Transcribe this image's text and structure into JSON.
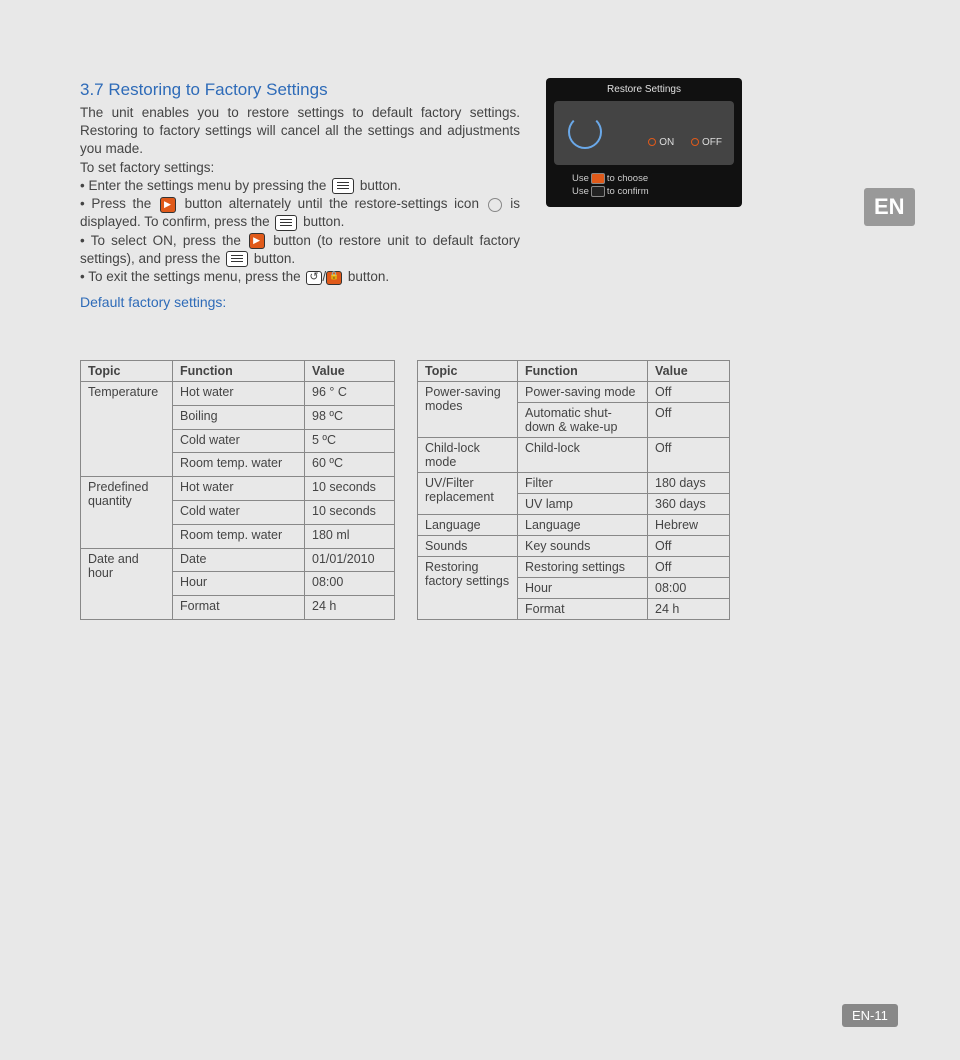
{
  "section_title": "3.7 Restoring to Factory Settings",
  "intro_1": "The unit enables you to restore settings to default factory settings. Restoring to factory settings will cancel all the settings and adjustments you made.",
  "intro_2": "To set factory settings:",
  "bullet_1a": "• Enter the settings menu by pressing the ",
  "bullet_1b": " button.",
  "bullet_2a": "• Press the ",
  "bullet_2b": " button alternately until the restore-settings icon ",
  "bullet_2c": " is displayed. To confirm, press the ",
  "bullet_2d": " button.",
  "bullet_3a": "• To select ON, press the ",
  "bullet_3b": " button (to restore unit to default factory settings), and press the ",
  "bullet_3c": " button.",
  "bullet_4a": "• To exit the settings menu, press the ",
  "bullet_4b": " button.",
  "defaults_title": "Default factory settings:",
  "panel": {
    "title": "Restore Settings",
    "on": "ON",
    "off": "OFF",
    "hint1a": "Use",
    "hint1b": "to choose",
    "hint2a": "Use",
    "hint2b": "to confirm"
  },
  "lang_badge": "EN",
  "page_number": "EN-11",
  "table_headers": {
    "topic": "Topic",
    "function": "Function",
    "value": "Value"
  },
  "table1": [
    {
      "topic": "Temperature",
      "rows": [
        {
          "f": "Hot water",
          "v": "96 ° C"
        },
        {
          "f": "Boiling",
          "v": "98 ºC"
        },
        {
          "f": "Cold water",
          "v": "5 ºC"
        },
        {
          "f": "Room temp. water",
          "v": "60 ºC"
        }
      ]
    },
    {
      "topic": "Predefined quantity",
      "rows": [
        {
          "f": "Hot water",
          "v": "10 seconds"
        },
        {
          "f": "Cold water",
          "v": "10 seconds"
        },
        {
          "f": "Room temp. water",
          "v": "180 ml"
        }
      ]
    },
    {
      "topic": "Date and hour",
      "rows": [
        {
          "f": "Date",
          "v": "01/01/2010"
        },
        {
          "f": "Hour",
          "v": "08:00"
        },
        {
          "f": "Format",
          "v": "24 h"
        }
      ]
    }
  ],
  "table2": [
    {
      "topic": "Power-saving modes",
      "rows": [
        {
          "f": "Power-saving mode",
          "v": "Off"
        },
        {
          "f": "Automatic shut-down & wake-up",
          "v": "Off"
        }
      ]
    },
    {
      "topic": "Child-lock mode",
      "rows": [
        {
          "f": "Child-lock",
          "v": "Off"
        }
      ]
    },
    {
      "topic": "UV/Filter replacement",
      "rows": [
        {
          "f": "Filter",
          "v": "180 days"
        },
        {
          "f": "UV lamp",
          "v": "360 days"
        }
      ]
    },
    {
      "topic": "Language",
      "rows": [
        {
          "f": "Language",
          "v": "Hebrew"
        }
      ]
    },
    {
      "topic": "Sounds",
      "rows": [
        {
          "f": "Key sounds",
          "v": "Off"
        }
      ]
    },
    {
      "topic": "Restoring factory settings",
      "rows": [
        {
          "f": "Restoring settings",
          "v": "Off"
        },
        {
          "f": "Hour",
          "v": "08:00"
        },
        {
          "f": "Format",
          "v": "24 h"
        }
      ]
    }
  ]
}
